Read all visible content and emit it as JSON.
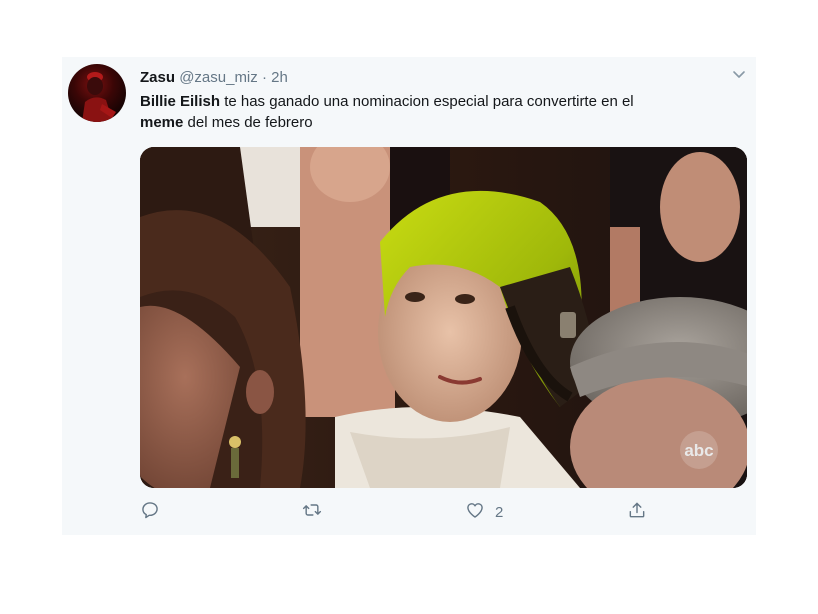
{
  "tweet": {
    "name": "Zasu",
    "handle": "@zasu_miz",
    "separator": "·",
    "time": "2h",
    "text_bold_1": "Billie Eilish",
    "text_1": " te has ganado una nominacion especial para convertirte en el",
    "text_bold_2": "meme",
    "text_2": " del mes de febrero",
    "media_watermark": "abc",
    "likes": "2"
  },
  "icons": {
    "reply": "reply-icon",
    "retweet": "retweet-icon",
    "like": "heart-icon",
    "share": "share-icon",
    "menu": "chevron-down-icon"
  },
  "colors": {
    "background": "#f5f8fa",
    "text": "#14171a",
    "muted": "#657786",
    "hair_green": "#b5d10a"
  }
}
